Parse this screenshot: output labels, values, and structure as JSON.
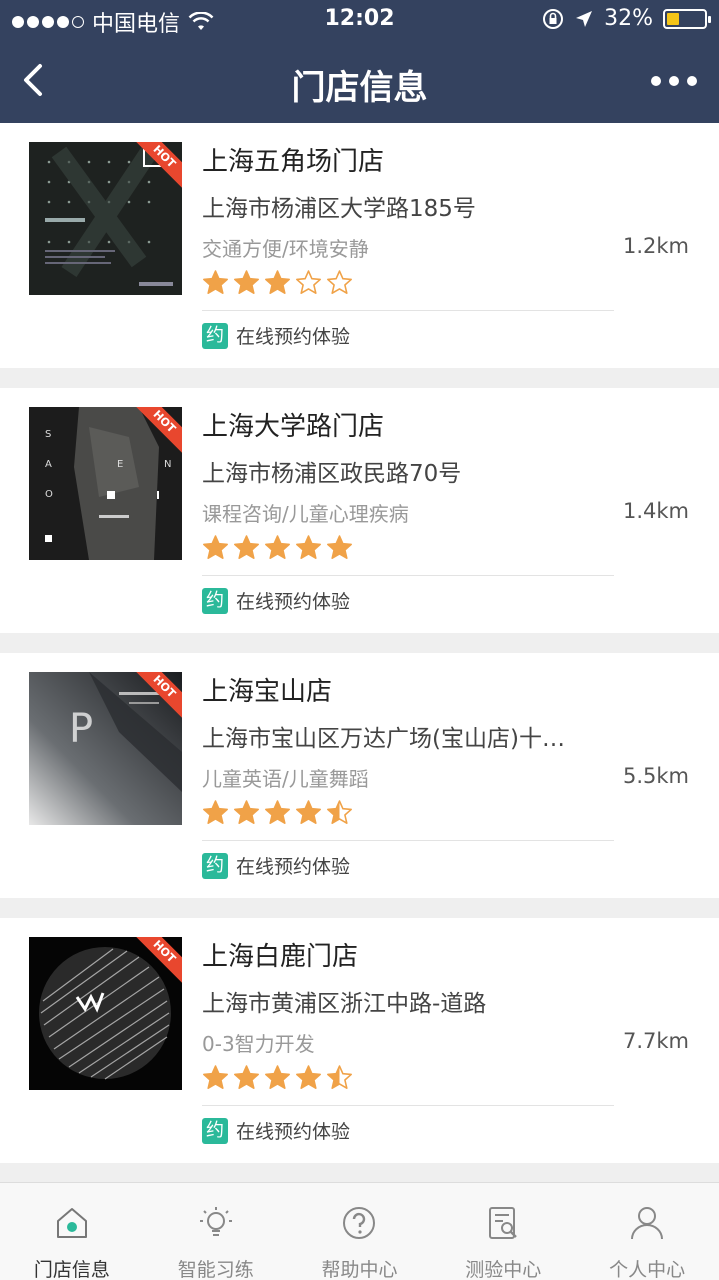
{
  "status_bar": {
    "carrier": "中国电信",
    "time": "12:02",
    "battery": "32%"
  },
  "navbar": {
    "title": "门店信息"
  },
  "stores": [
    {
      "name": "上海五角场门店",
      "address": "上海市杨浦区大学路185号",
      "tags": "交通方便/环境安静",
      "distance": "1.2km",
      "rating": 3,
      "hot": "HOT",
      "booking_icon": "约",
      "booking_label": "在线预约体验"
    },
    {
      "name": "上海大学路门店",
      "address": "上海市杨浦区政民路70号",
      "tags": "课程咨询/儿童心理疾病",
      "distance": "1.4km",
      "rating": 5,
      "hot": "HOT",
      "booking_icon": "约",
      "booking_label": "在线预约体验"
    },
    {
      "name": "上海宝山店",
      "address": "上海市宝山区万达广场(宝山店)十…",
      "tags": "儿童英语/儿童舞蹈",
      "distance": "5.5km",
      "rating": 4.5,
      "hot": "HOT",
      "booking_icon": "约",
      "booking_label": "在线预约体验"
    },
    {
      "name": "上海白鹿门店",
      "address": "上海市黄浦区浙江中路-道路",
      "tags": "0-3智力开发",
      "distance": "7.7km",
      "rating": 4.5,
      "hot": "HOT",
      "booking_icon": "约",
      "booking_label": "在线预约体验"
    }
  ],
  "tabbar": [
    {
      "label": "门店信息",
      "icon": "home-icon",
      "active": true
    },
    {
      "label": "智能习练",
      "icon": "lightbulb-icon",
      "active": false
    },
    {
      "label": "帮助中心",
      "icon": "help-icon",
      "active": false
    },
    {
      "label": "测验中心",
      "icon": "test-icon",
      "active": false
    },
    {
      "label": "个人中心",
      "icon": "user-icon",
      "active": false
    }
  ],
  "colors": {
    "header_bg": "#34425f",
    "star": "#f0a248",
    "booking_accent": "#2bb99a",
    "hot_badge": "#e8472e"
  }
}
